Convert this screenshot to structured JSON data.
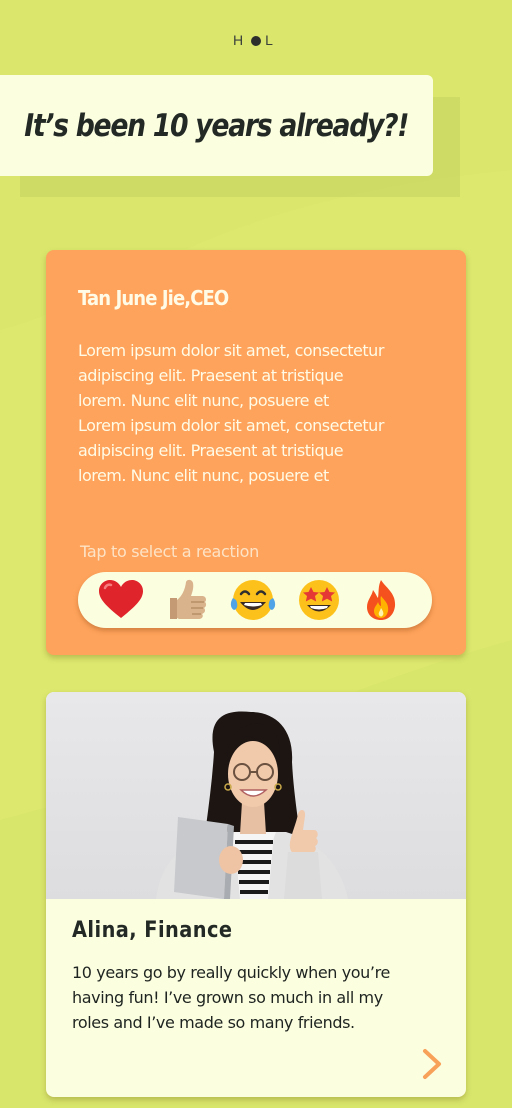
{
  "logo": {
    "left": "H",
    "right": "L"
  },
  "header": {
    "title": "It’s been 10 years already?!"
  },
  "ceo_card": {
    "name": "Tan June Jie,CEO",
    "body_lines": [
      "Lorem ipsum dolor sit amet, consectetur",
      "adipiscing elit. Praesent at tristique",
      "lorem. Nunc elit nunc, posuere et",
      "Lorem ipsum dolor sit amet, consectetur",
      "adipiscing elit. Praesent at tristique",
      "lorem. Nunc elit nunc, posuere et"
    ],
    "reaction_hint": "Tap to select a reaction",
    "reactions": [
      "red-heart",
      "thumbs-up",
      "tears-of-joy",
      "star-struck",
      "fire"
    ]
  },
  "profile_card": {
    "photo": "smiling-woman-holding-laptop-thumbs-up",
    "name": "Alina, Finance",
    "quote_lines": [
      "10 years go by really quickly when you’re",
      "having fun! I’ve grown so much in all my",
      "roles and I’ve made so many friends."
    ],
    "next_icon": "chevron-right-icon"
  },
  "colors": {
    "background": "#dce86e",
    "card_orange": "#fea35b",
    "card_cream": "#fcfee0",
    "title_text": "#232a26",
    "accent_arrow": "#f7a159"
  }
}
